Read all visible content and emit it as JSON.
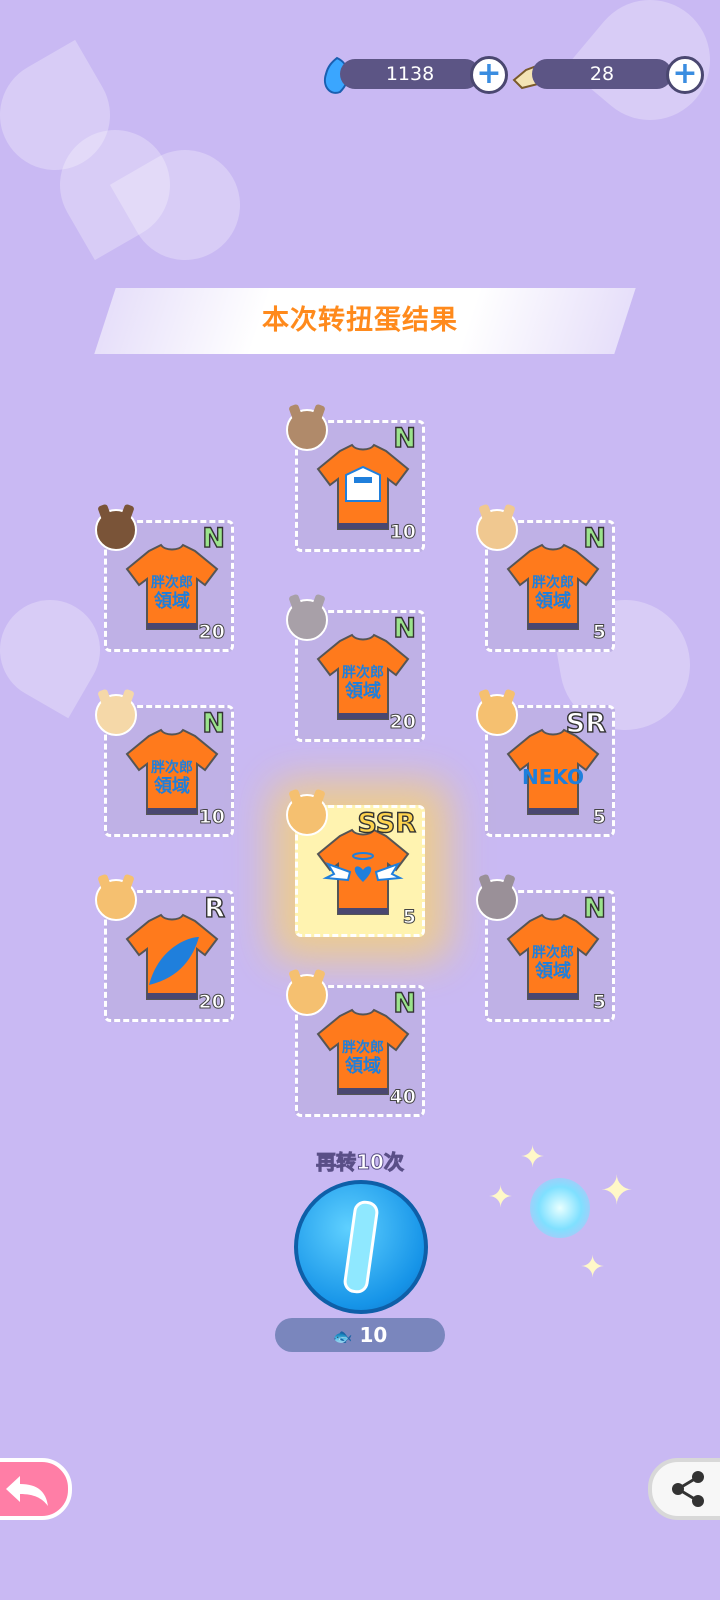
{
  "resources": {
    "gems": {
      "icon": "blue-gem-icon",
      "value": "1138"
    },
    "tickets": {
      "icon": "fish-ticket-icon",
      "value": "28"
    }
  },
  "banner": {
    "title": "本次转扭蛋结果"
  },
  "results": [
    {
      "rarity": "N",
      "count": "10",
      "design": "white-logo-shirt"
    },
    {
      "rarity": "N",
      "count": "20",
      "design": "pangjilang-shirt"
    },
    {
      "rarity": "N",
      "count": "5",
      "design": "pangjilang-shirt"
    },
    {
      "rarity": "N",
      "count": "20",
      "design": "pangjilang-shirt"
    },
    {
      "rarity": "N",
      "count": "10",
      "design": "pangjilang-shirt"
    },
    {
      "rarity": "SR",
      "count": "5",
      "design": "neko-shirt"
    },
    {
      "rarity": "SSR",
      "count": "5",
      "design": "winged-heart-shirt"
    },
    {
      "rarity": "R",
      "count": "20",
      "design": "blue-wing-shirt"
    },
    {
      "rarity": "N",
      "count": "5",
      "design": "pangjilang-shirt"
    },
    {
      "rarity": "N",
      "count": "40",
      "design": "pangjilang-shirt"
    }
  ],
  "shirt_text": {
    "line1": "胖次郎",
    "line2": "領域",
    "neko": "NEKO"
  },
  "spin_again": {
    "label": "再转10次",
    "cost": "10"
  },
  "buttons": {
    "back": "back-arrow-icon",
    "share": "share-icon"
  },
  "colors": {
    "accent": "#ff8a1c",
    "background": "#c9b9f3",
    "spin_button": "#1694e8",
    "back_button": "#ff7ea6"
  }
}
